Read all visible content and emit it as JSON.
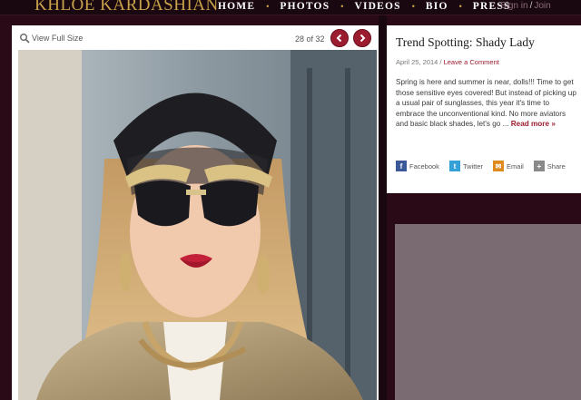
{
  "site": {
    "brand": "KHLOE KARDASHIAN"
  },
  "nav": {
    "items": [
      "HOME",
      "PHOTOS",
      "VIDEOS",
      "BIO",
      "PRESS"
    ]
  },
  "account": {
    "sign_in": "Sign in",
    "separator": "/",
    "join": "Join"
  },
  "gallery": {
    "view_full_size": "View Full Size",
    "counter": "28 of 32",
    "prev_icon": "chevron-left-icon",
    "next_icon": "chevron-right-icon"
  },
  "article": {
    "title": "Trend Spotting: Shady Lady",
    "date": "April 25, 2014",
    "meta_sep": "/",
    "comment_link": "Leave a Comment",
    "body": "Spring is here and summer is near, dolls!!! Time to get those sensitive eyes covered! But instead of picking up a usual pair of sunglasses, this year it's time to embrace the unconventional kind. No more aviators and basic black shades, let's go ...",
    "read_more": "Read more »",
    "share": [
      {
        "label": "Facebook",
        "icon": "facebook-icon",
        "color": "#3b5998",
        "glyph": "f"
      },
      {
        "label": "Twitter",
        "icon": "twitter-icon",
        "color": "#33a0d8",
        "glyph": "t"
      },
      {
        "label": "Email",
        "icon": "email-icon",
        "color": "#e08a1e",
        "glyph": "✉"
      },
      {
        "label": "Share",
        "icon": "share-plus-icon",
        "color": "#8a8a8a",
        "glyph": "+"
      }
    ]
  },
  "colors": {
    "accent": "#9b1c2e",
    "brand_gold": "#c9a24a",
    "background": "#2a0a16"
  }
}
